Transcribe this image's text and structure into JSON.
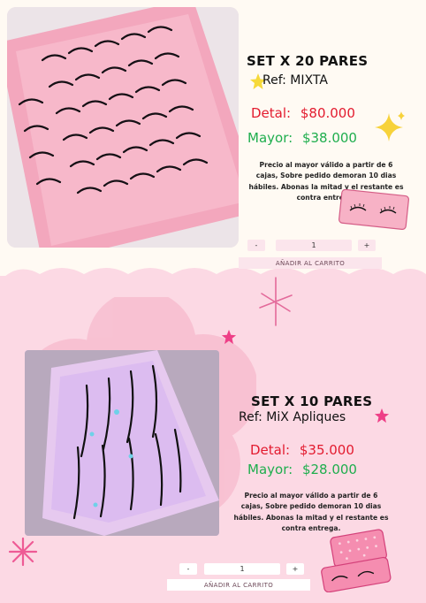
{
  "product1": {
    "title": "SET X 20 PARES",
    "ref": "Ref: MIXTA",
    "detal_label": "Detal:",
    "detal_price": "$80.000",
    "mayor_label": "Mayor:",
    "mayor_price": "$38.000",
    "description": "Precio al mayor válido a partir de 6 cajas, Sobre pedido demoran 10 dias hábiles. Abonas la mitad y el restante es contra entrega.",
    "qty_minus": "-",
    "qty_value": "1",
    "qty_plus": "+",
    "add_to_cart": "AÑADIR AL CARRITO"
  },
  "product2": {
    "title": "SET X 10 PARES",
    "ref": "Ref: MiX Apliques",
    "detal_label": "Detal:",
    "detal_price": "$35.000",
    "mayor_label": "Mayor:",
    "mayor_price": "$28.000",
    "description": "Precio al mayor válido a partir de 6 cajas, Sobre pedido demoran 10 dias hábiles. Abonas la mitad y el restante es contra entrega.",
    "qty_minus": "-",
    "qty_value": "1",
    "qty_plus": "+",
    "add_to_cart": "AÑADIR AL CARRITO"
  },
  "colors": {
    "detal": "#e31b2f",
    "mayor": "#1fae4e",
    "pink_bg": "#fcd9e4",
    "cream_bg": "#fffaf3"
  },
  "icons": [
    "sparkle-icon",
    "star-icon",
    "lash-box-icon",
    "asterisk-icon"
  ]
}
